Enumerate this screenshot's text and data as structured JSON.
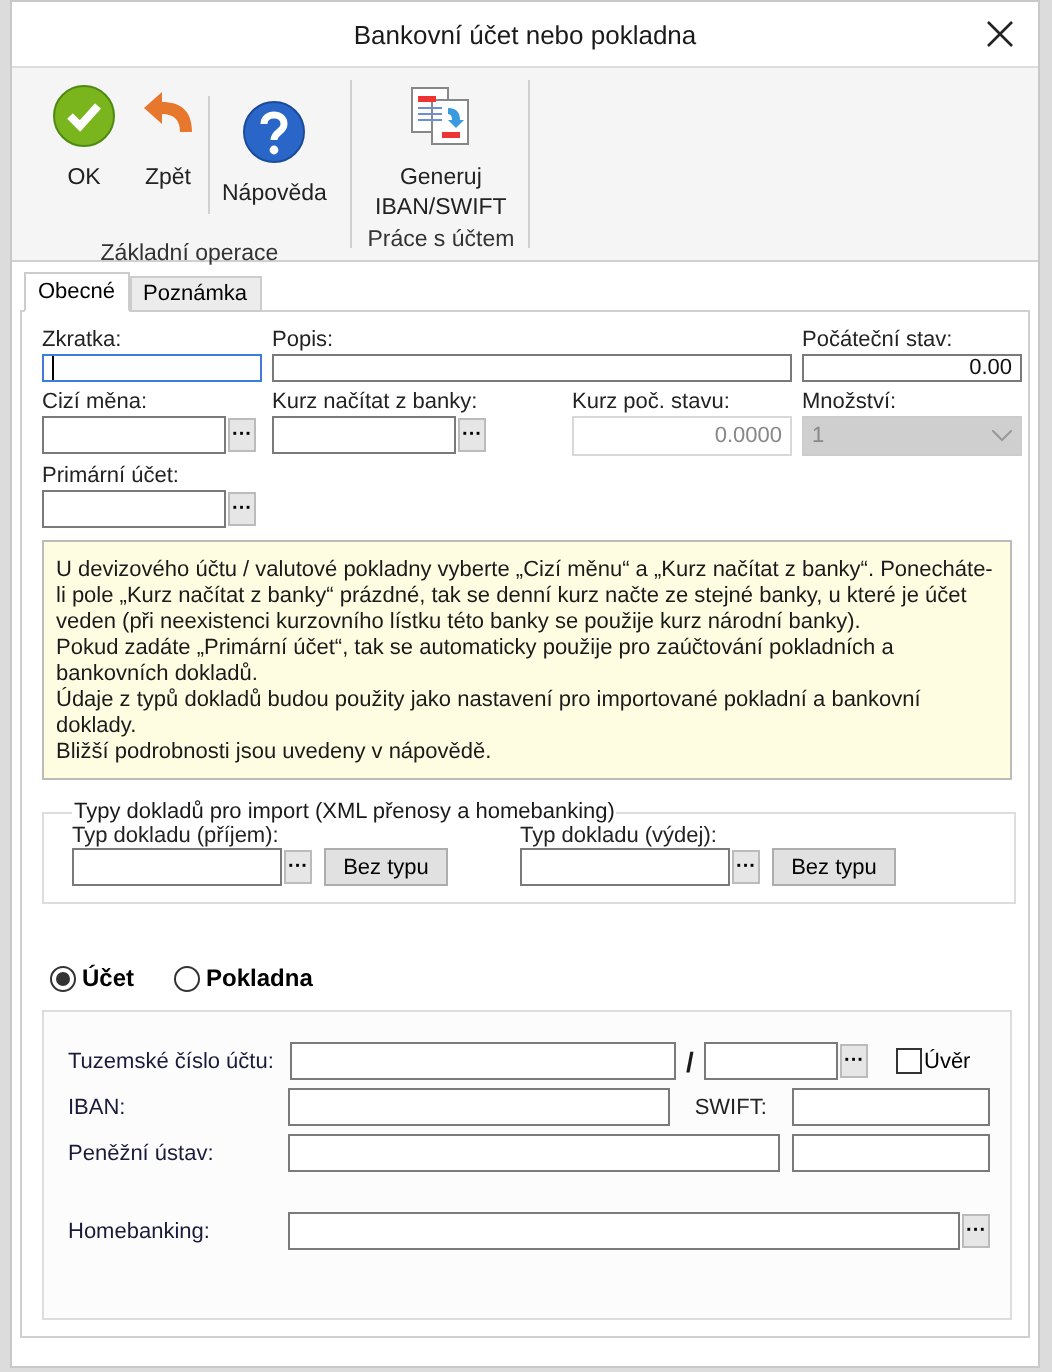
{
  "window": {
    "title": "Bankovní účet nebo pokladna"
  },
  "ribbon": [
    {
      "label": "Základní operace",
      "sections": [
        [
          {
            "kind": "ok",
            "label": "OK"
          },
          {
            "kind": "back",
            "label": "Zpět"
          }
        ],
        [
          {
            "kind": "help",
            "label": "Nápověda"
          }
        ]
      ]
    },
    {
      "label": "Práce s účtem",
      "sections": [
        [
          {
            "kind": "generate",
            "label": "Generuj IBAN/SWIFT"
          }
        ]
      ]
    }
  ],
  "tabs": [
    {
      "label": "Obecné",
      "selected": true
    },
    {
      "label": "Poznámka",
      "selected": false
    }
  ],
  "fields": [
    {
      "kind": "text",
      "label": "Zkratka:",
      "focused": true,
      "disabled": false
    },
    {
      "kind": "text",
      "label": "Popis:",
      "focused": false,
      "disabled": false
    },
    {
      "kind": "text",
      "label": "Počáteční stav:",
      "value": "0.00",
      "focused": false,
      "disabled": false
    },
    {
      "kind": "lookup",
      "label": "Cizí měna:",
      "button": "···",
      "focused": false,
      "disabled": false
    },
    {
      "kind": "lookup",
      "label": "Kurz načítat z banky:",
      "button": "···",
      "focused": false,
      "disabled": false
    },
    {
      "kind": "text",
      "label": "Kurz poč. stavu:",
      "value": "0.0000",
      "focused": false,
      "disabled": true
    },
    {
      "kind": "select",
      "label": "Množství:",
      "value": "1",
      "focused": false,
      "disabled": true
    },
    {
      "kind": "lookup",
      "label": "Primární účet:",
      "button": "···",
      "focused": false,
      "disabled": false
    }
  ],
  "info": [
    "U devizového účtu / valutové pokladny vyberte „Cizí měnu“ a „Kurz načítat z banky“. Ponecháte-li pole „Kurz načítat z banky“ prázdné, tak se denní kurz načte ze stejné banky, u které je účet veden (při neexistenci kurzovního lístku této banky se použije kurz národní banky).",
    "Pokud zadáte „Primární účet“, tak se automaticky použije pro zaúčtování pokladních a bankovních dokladů.",
    "Údaje z typů dokladů budou použity jako nastavení pro importované pokladní a bankovní doklady.",
    "Bližší podrobnosti jsou uvedeny v nápovědě."
  ],
  "import_group": {
    "legend": "Typy dokladů pro import (XML přenosy a homebanking)",
    "items": [
      {
        "label": "Typ dokladu (příjem):",
        "button": "···",
        "action": "Bez typu"
      },
      {
        "label": "Typ dokladu (výdej):",
        "button": "···",
        "action": "Bez typu"
      }
    ]
  },
  "mode": [
    {
      "label": "Účet",
      "selected": true
    },
    {
      "label": "Pokladna",
      "selected": false
    }
  ],
  "account": {
    "number_label": "Tuzemské číslo účtu:",
    "separator": "/",
    "bank_button": "···",
    "credit": {
      "label": "Úvěr",
      "checked": false
    },
    "iban_label": "IBAN:",
    "swift_label": "SWIFT:",
    "institution_label": "Peněžní ústav:",
    "homebanking_label": "Homebanking:",
    "homebanking_button": "···"
  }
}
